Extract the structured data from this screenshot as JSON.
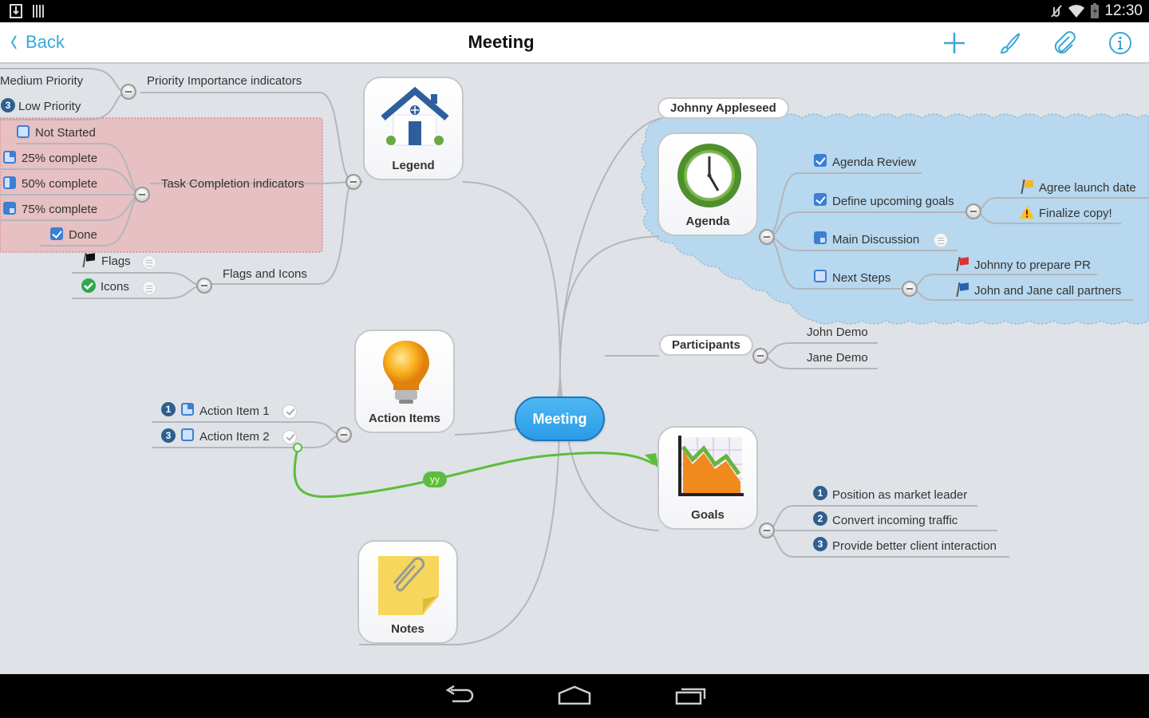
{
  "status_bar": {
    "left_icons": [
      "download-notification-icon",
      "barcode-notification-icon"
    ],
    "right_icons": [
      "mute-icon",
      "wifi-icon",
      "battery-charging-icon"
    ],
    "time": "12:30"
  },
  "action_bar": {
    "back_label": "Back",
    "title": "Meeting",
    "actions": [
      {
        "name": "add-icon",
        "label": "Add"
      },
      {
        "name": "brush-icon",
        "label": "Style"
      },
      {
        "name": "paperclip-icon",
        "label": "Attach"
      },
      {
        "name": "info-icon",
        "label": "Info"
      }
    ]
  },
  "colors": {
    "accent": "#3aa7d6",
    "central_topic": "#2a9be6",
    "boundary_red": "#e6c0c2",
    "boundary_blue": "#b7d8ee",
    "relationship_green": "#5cbd3c",
    "canvas": "#dfe2e7"
  },
  "mindmap": {
    "central": "Meeting",
    "legend": {
      "label": "Legend",
      "priority": {
        "label": "Priority Importance indicators",
        "items": [
          {
            "label": "Medium Priority"
          },
          {
            "label": "Low Priority",
            "priority": "3"
          }
        ]
      },
      "task_completion": {
        "label": "Task Completion indicators",
        "items": [
          {
            "label": "Not Started",
            "progress": "0%"
          },
          {
            "label": "25% complete",
            "progress": "25%"
          },
          {
            "label": "50% complete",
            "progress": "50%"
          },
          {
            "label": "75% complete",
            "progress": "75%"
          },
          {
            "label": "Done",
            "progress": "100%"
          }
        ]
      },
      "flags_icons": {
        "label": "Flags and Icons",
        "items": [
          {
            "label": "Flags",
            "icon": "black-flag-icon"
          },
          {
            "label": "Icons",
            "icon": "green-check-icon"
          }
        ]
      }
    },
    "action_items": {
      "label": "Action Items",
      "items": [
        {
          "label": "Action Item 1",
          "priority": "1",
          "progress": "25%"
        },
        {
          "label": "Action Item 2",
          "priority": "3",
          "progress": "0%"
        }
      ]
    },
    "notes": {
      "label": "Notes"
    },
    "agenda": {
      "callout": "Johnny Appleseed",
      "label": "Agenda",
      "items": [
        {
          "label": "Agenda Review",
          "progress": "100%"
        },
        {
          "label": "Define upcoming goals",
          "progress": "100%",
          "children": [
            {
              "label": "Agree launch date",
              "icon": "yellow-flag-icon"
            },
            {
              "label": "Finalize copy!",
              "icon": "warning-icon"
            }
          ]
        },
        {
          "label": "Main Discussion",
          "progress": "75%"
        },
        {
          "label": "Next Steps",
          "progress": "0%",
          "children": [
            {
              "label": "Johnny to prepare PR",
              "icon": "red-flag-icon"
            },
            {
              "label": "John and Jane call partners",
              "icon": "blue-flag-icon"
            }
          ]
        }
      ]
    },
    "participants": {
      "label": "Participants",
      "items": [
        {
          "label": "John Demo"
        },
        {
          "label": "Jane Demo"
        }
      ]
    },
    "goals": {
      "label": "Goals",
      "items": [
        {
          "label": "Position as market leader",
          "priority": "1"
        },
        {
          "label": "Convert incoming traffic",
          "priority": "2"
        },
        {
          "label": "Provide better client interaction",
          "priority": "3"
        }
      ]
    },
    "relationship_label": "yy"
  },
  "nav_bar": {
    "buttons": [
      "back-nav-icon",
      "home-nav-icon",
      "recents-nav-icon"
    ]
  }
}
